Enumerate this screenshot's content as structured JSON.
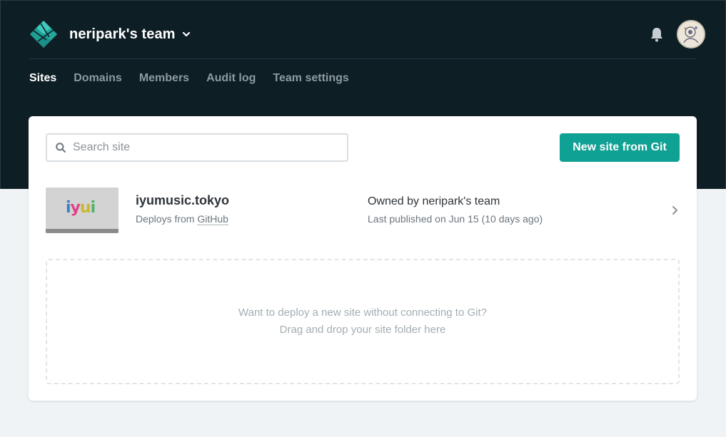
{
  "header": {
    "team_name": "neripark's team",
    "logo_icon": "netlify-logo-icon",
    "notification_icon": "bell-icon",
    "avatar_icon": "user-avatar"
  },
  "nav": {
    "items": [
      {
        "label": "Sites",
        "active": true
      },
      {
        "label": "Domains",
        "active": false
      },
      {
        "label": "Members",
        "active": false
      },
      {
        "label": "Audit log",
        "active": false
      },
      {
        "label": "Team settings",
        "active": false
      }
    ]
  },
  "search": {
    "placeholder": "Search site",
    "value": ""
  },
  "actions": {
    "new_site_label": "New site from Git"
  },
  "sites": [
    {
      "name": "iyumusic.tokyo",
      "thumbnail_text": "iyui",
      "deploy_prefix": "Deploys from ",
      "deploy_source": "GitHub",
      "owner": "Owned by neripark's team",
      "published": "Last published on Jun 15 (10 days ago)"
    }
  ],
  "dropzone": {
    "line1": "Want to deploy a new site without connecting to Git?",
    "line2": "Drag and drop your site folder here"
  },
  "colors": {
    "header_bg": "#0e1e25",
    "accent": "#0fa193",
    "page_bg": "#f0f3f6"
  }
}
